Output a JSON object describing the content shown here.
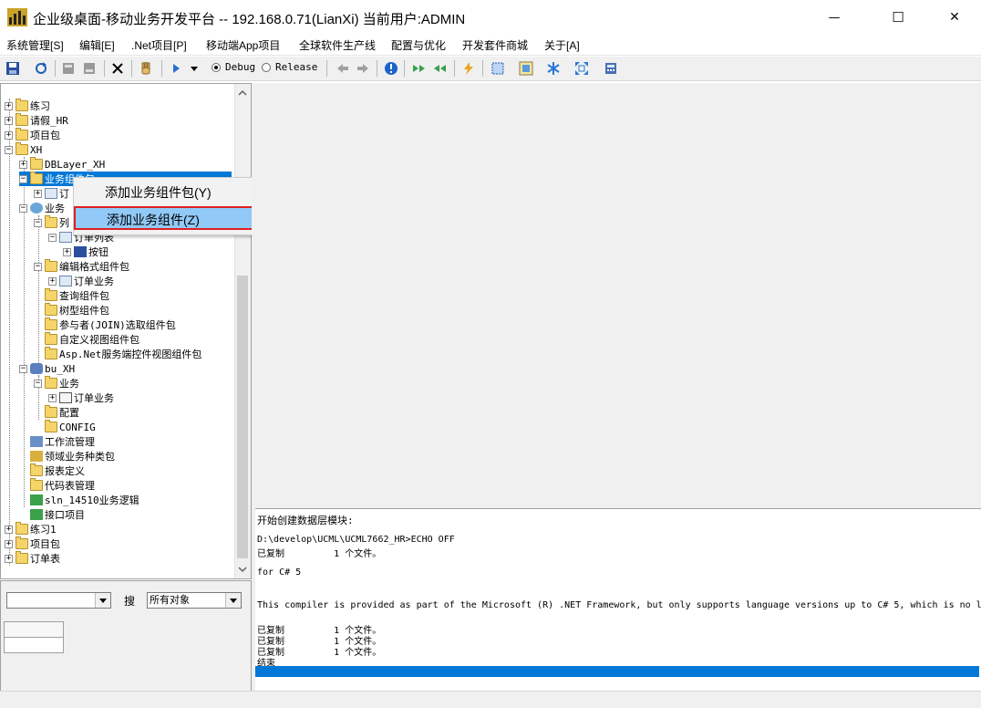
{
  "window": {
    "title": "企业级桌面-移动业务开发平台 -- 192.168.0.71(LianXi) 当前用户:ADMIN",
    "controls": {
      "minimize": "—",
      "maximize": "☐",
      "close": "✕"
    }
  },
  "menu": [
    "系统管理[S]",
    "编辑[E]",
    ".Net项目[P]",
    "移动端App项目",
    "全球软件生产线",
    "配置与优化",
    "开发套件商城",
    "关于[A]"
  ],
  "toolbar": {
    "debug_label": "Debug",
    "release_label": "Release",
    "selected_mode": "Debug"
  },
  "tree": {
    "nodes": [
      {
        "label": "练习"
      },
      {
        "label": "请假_HR"
      },
      {
        "label": "项目包"
      },
      {
        "label": "XH"
      },
      {
        "label": "DBLayer_XH"
      },
      {
        "label": "业务组件包"
      },
      {
        "label": "订"
      },
      {
        "label": "业务"
      },
      {
        "label": "列"
      },
      {
        "label": "订单列表"
      },
      {
        "label": "按钮"
      },
      {
        "label": "编辑格式组件包"
      },
      {
        "label": "订单业务"
      },
      {
        "label": "查询组件包"
      },
      {
        "label": "树型组件包"
      },
      {
        "label": "参与者(JOIN)选取组件包"
      },
      {
        "label": "自定义视图组件包"
      },
      {
        "label": "Asp.Net服务端控件视图组件包"
      },
      {
        "label": "bu_XH"
      },
      {
        "label": "业务"
      },
      {
        "label": "订单业务"
      },
      {
        "label": "配置"
      },
      {
        "label": "CONFIG"
      },
      {
        "label": "工作流管理"
      },
      {
        "label": "领域业务种类包"
      },
      {
        "label": "报表定义"
      },
      {
        "label": "代码表管理"
      },
      {
        "label": "sln_14510业务逻辑"
      },
      {
        "label": "接口项目"
      },
      {
        "label": "练习1"
      },
      {
        "label": "项目包"
      },
      {
        "label": "订单表"
      }
    ]
  },
  "context_menu": {
    "items": [
      {
        "label": "添加业务组件包(Y)"
      },
      {
        "label": "添加业务组件(Z)"
      }
    ]
  },
  "search": {
    "search_label": "搜",
    "scope_value": "所有对象",
    "left_value": ""
  },
  "output": {
    "lines": [
      "开始创建数据层模块:",
      "",
      "D:\\develop\\UCML\\UCML7662_HR>ECHO OFF",
      "已复制         1 个文件。",
      "",
      "for C# 5",
      "",
      "",
      "This compiler is provided as part of the Microsoft (R) .NET Framework, but only supports language versions up to C# 5, which is no l",
      "",
      "已复制         1 个文件。",
      "已复制         1 个文件。",
      "已复制         1 个文件。",
      "结束"
    ]
  },
  "colors": {
    "accent": "#0078d7",
    "context_highlight": "#91c9f7",
    "context_border": "#e02020",
    "folder": "#f5d46a"
  }
}
